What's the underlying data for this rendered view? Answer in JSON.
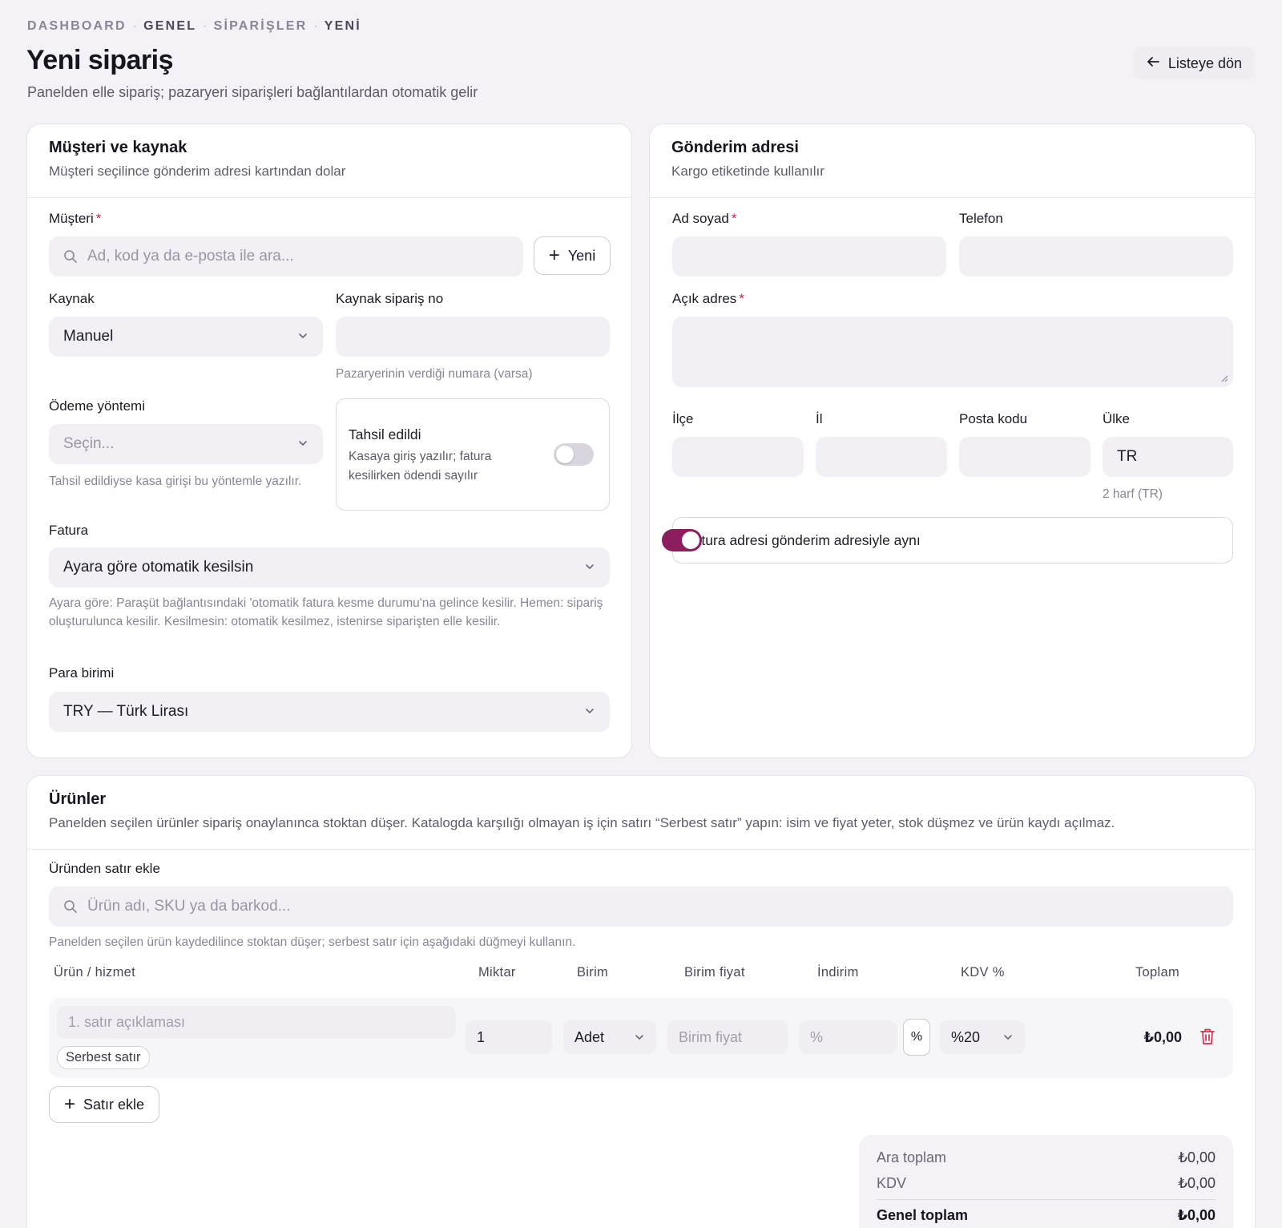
{
  "breadcrumb": [
    "DASHBOARD",
    "GENEL",
    "SİPARİŞLER",
    "YENİ"
  ],
  "page": {
    "title": "Yeni sipariş",
    "subtitle": "Panelden elle sipariş; pazaryeri siparişleri bağlantılardan otomatik gelir",
    "back_label": "Listeye dön"
  },
  "customer_card": {
    "title": "Müşteri ve kaynak",
    "desc": "Müşteri seçilince gönderim adresi kartından dolar",
    "customer_label": "Müşteri",
    "customer_placeholder": "Ad, kod ya da e-posta ile ara...",
    "new_label": "Yeni",
    "source_label": "Kaynak",
    "source_value": "Manuel",
    "source_order_label": "Kaynak sipariş no",
    "source_order_hint": "Pazaryerinin verdiği numara (varsa)",
    "payment_label": "Ödeme yöntemi",
    "payment_placeholder": "Seçin...",
    "payment_hint": "Tahsil edildiyse kasa girişi bu yöntemle yazılır.",
    "collected_title": "Tahsil edildi",
    "collected_desc": "Kasaya giriş yazılır; fatura kesilirken ödendi sayılır",
    "invoice_label": "Fatura",
    "invoice_value": "Ayara göre otomatik kesilsin",
    "invoice_hint": "Ayara göre: Paraşüt bağlantısındaki 'otomatik fatura kesme durumu'na gelince kesilir. Hemen: sipariş oluşturulunca kesilir. Kesilmesin: otomatik kesilmez, istenirse siparişten elle kesilir.",
    "currency_label": "Para birimi",
    "currency_value": "TRY — Türk Lirası"
  },
  "shipping_card": {
    "title": "Gönderim adresi",
    "desc": "Kargo etiketinde kullanılır",
    "name_label": "Ad soyad",
    "phone_label": "Telefon",
    "address_label": "Açık adres",
    "district_label": "İlçe",
    "city_label": "İl",
    "postal_label": "Posta kodu",
    "country_label": "Ülke",
    "country_value": "TR",
    "country_hint": "2 harf (TR)",
    "same_billing_label": "Fatura adresi gönderim adresiyle aynı"
  },
  "products_card": {
    "title": "Ürünler",
    "desc": "Panelden seçilen ürünler sipariş onaylanınca stoktan düşer. Katalogda karşılığı olmayan iş için satırı “Serbest satır” yapın: isim ve fiyat yeter, stok düşmez ve ürün kaydı açılmaz.",
    "add_from_product_label": "Üründen satır ekle",
    "product_search_placeholder": "Ürün adı, SKU ya da barkod...",
    "product_hint": "Panelden seçilen ürün kaydedilince stoktan düşer; serbest satır için aşağıdaki düğmeyi kullanın.",
    "columns": [
      "Ürün / hizmet",
      "Miktar",
      "Birim",
      "Birim fiyat",
      "İndirim",
      "KDV %",
      "Toplam"
    ],
    "row": {
      "desc_placeholder": "1. satır açıklaması",
      "tag": "Serbest satır",
      "qty": "1",
      "unit": "Adet",
      "price_placeholder": "Birim fiyat",
      "discount_placeholder": "%",
      "discount_mode": "%",
      "vat": "%20",
      "total": "₺0,00"
    },
    "add_row_label": "Satır ekle",
    "totals": {
      "subtotal_label": "Ara toplam",
      "subtotal_value": "₺0,00",
      "vat_label": "KDV",
      "vat_value": "₺0,00",
      "grand_label": "Genel toplam",
      "grand_value": "₺0,00"
    }
  },
  "colors": {
    "accent": "#8c1d5e",
    "required": "#c0264e",
    "delete": "#d0314d"
  }
}
